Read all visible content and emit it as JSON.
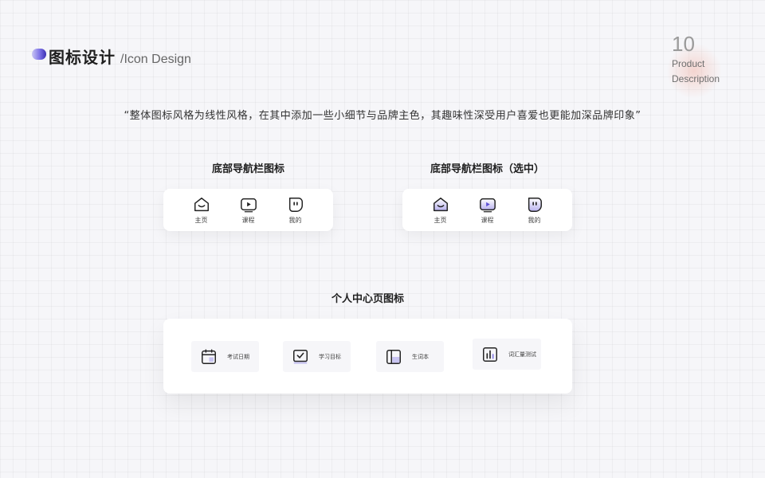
{
  "header": {
    "title_cn": "图标设计",
    "title_en": "/Icon Design"
  },
  "page": {
    "number": "10",
    "label": "Product Description"
  },
  "quote": "“整体图标风格为线性风格，在其中添加一些小细节与品牌主色，其趣味性深受用户喜爱也更能加深品牌印象”",
  "colors": {
    "brand": "#5b4fd4",
    "brand_light": "#c9c5f2",
    "stroke": "#222222"
  },
  "nav_default": {
    "title": "底部导航栏图标",
    "items": [
      {
        "label": "主页",
        "icon": "home-icon"
      },
      {
        "label": "课程",
        "icon": "play-icon"
      },
      {
        "label": "我的",
        "icon": "profile-face-icon"
      }
    ]
  },
  "nav_selected": {
    "title": "底部导航栏图标（选中）",
    "items": [
      {
        "label": "主页",
        "icon": "home-icon"
      },
      {
        "label": "课程",
        "icon": "play-icon"
      },
      {
        "label": "我的",
        "icon": "profile-face-icon"
      }
    ]
  },
  "profile": {
    "title": "个人中心页图标",
    "items": [
      {
        "label": "考试日期",
        "icon": "calendar-icon"
      },
      {
        "label": "学习目标",
        "icon": "checklist-icon"
      },
      {
        "label": "生词本",
        "icon": "notebook-icon"
      },
      {
        "label": "词汇量测试",
        "icon": "bar-chart-icon"
      }
    ]
  }
}
